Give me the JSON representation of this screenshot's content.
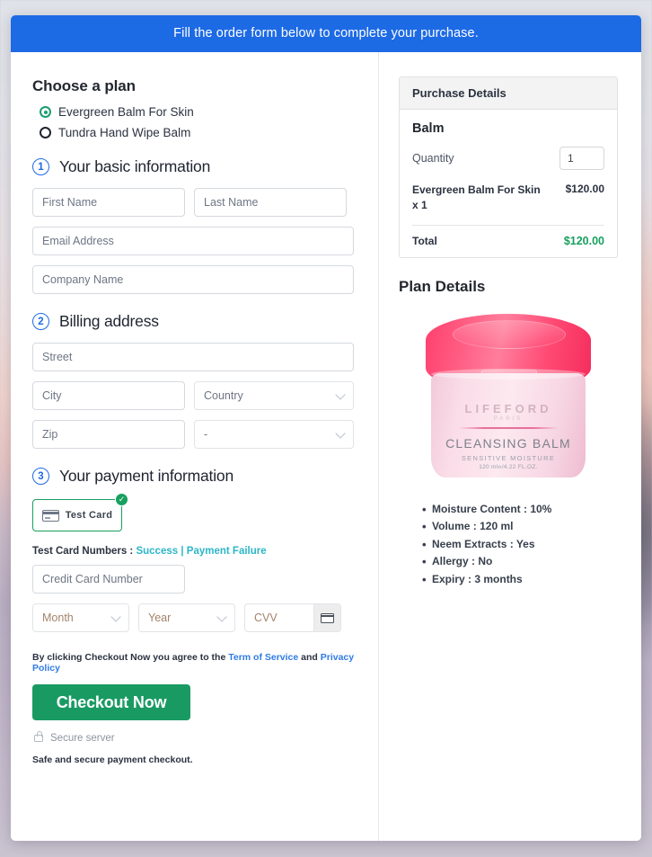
{
  "banner": {
    "text": "Fill the order form below to complete your purchase.",
    "bg_color": "#1d6ae5"
  },
  "plan": {
    "heading": "Choose a plan",
    "options": [
      {
        "label": "Evergreen Balm For Skin",
        "selected": true
      },
      {
        "label": "Tundra Hand Wipe Balm",
        "selected": false
      }
    ],
    "selected_color": "#1a9e6f"
  },
  "steps": [
    {
      "number": "1",
      "title": "Your basic information"
    },
    {
      "number": "2",
      "title": "Billing address"
    },
    {
      "number": "3",
      "title": "Your payment information"
    }
  ],
  "basic_info": {
    "first_name_placeholder": "First Name",
    "last_name_placeholder": "Last Name",
    "email_placeholder": "Email Address",
    "company_placeholder": "Company Name"
  },
  "billing": {
    "street_placeholder": "Street",
    "city_placeholder": "City",
    "country_value": "Country",
    "zip_placeholder": "Zip",
    "state_value": "-"
  },
  "payment": {
    "test_card_label": "Test Card",
    "test_card_selected": true,
    "card_icon": "credit-card-icon",
    "check_icon": "✓",
    "test_numbers_prefix": "Test Card Numbers :",
    "success_link": "Success",
    "separator": "|",
    "failure_link": "Payment Failure",
    "link_color": "#2bb6c6",
    "card_number_placeholder": "Credit Card Number",
    "month_value": "Month",
    "year_value": "Year",
    "cvv_placeholder": "CVV",
    "cvv_icon": "card-back-icon"
  },
  "footer": {
    "terms_prefix": "By clicking Checkout Now you agree to the",
    "terms_link": "Term of Service",
    "terms_and": "and",
    "privacy_link": "Privacy Policy",
    "checkout_label": "Checkout Now",
    "checkout_color": "#1a9a63",
    "secure_icon": "lock-icon",
    "secure_text": "Secure server",
    "safe_text": "Safe and secure payment checkout."
  },
  "purchase": {
    "panel_title": "Purchase Details",
    "product_name": "Balm",
    "quantity_label": "Quantity",
    "quantity_value": "1",
    "line_item": "Evergreen Balm For Skin x 1",
    "line_item_name": "Evergreen Balm For Skin",
    "line_item_qty": "x 1",
    "line_price": "$120.00",
    "total_label": "Total",
    "total_value": "$120.00",
    "total_color": "#17a05f"
  },
  "plan_details": {
    "heading": "Plan Details",
    "product_image": {
      "brand": "LIFEFORD",
      "brand_sub": "PARIS",
      "title": "CLEANSING BALM",
      "subtitle": "SENSITIVE MOISTURE",
      "volume": "120 ml℮/4.22 FL.OZ.",
      "lid_color": "#ff3f6e",
      "body_color": "#fadde8"
    },
    "specs": [
      "Moisture Content : 10%",
      "Volume : 120 ml",
      "Neem Extracts : Yes",
      "Allergy : No",
      "Expiry : 3 months"
    ]
  }
}
